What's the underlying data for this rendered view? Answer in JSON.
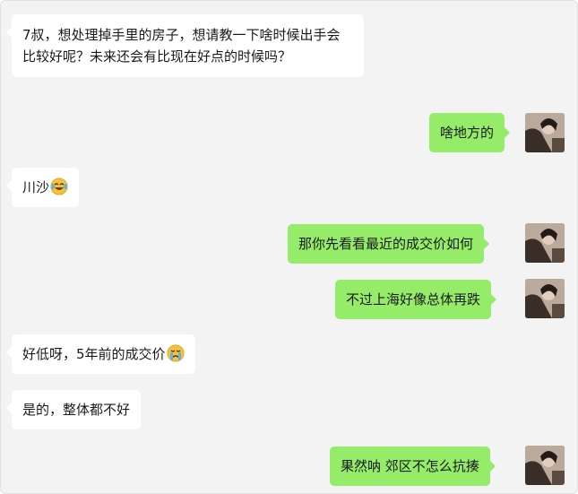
{
  "messages": [
    {
      "side": "in",
      "text": "7叔，想处理掉手里的房子，想请教一下啥时候出手会比较好呢？未来还会有比现在好点的时候吗？"
    },
    {
      "side": "out",
      "text": "啥地方的"
    },
    {
      "side": "in",
      "text": "川沙",
      "emoji": "laughing-tears-emoji"
    },
    {
      "side": "out",
      "text": "那你先看看最近的成交价如何"
    },
    {
      "side": "out",
      "text": "不过上海好像总体再跌"
    },
    {
      "side": "in",
      "text": "好低呀，5年前的成交价",
      "emoji": "crying-emoji"
    },
    {
      "side": "in",
      "text": "是的，整体都不好"
    },
    {
      "side": "out",
      "text": "果然呐 郊区不怎么抗揍"
    }
  ],
  "colors": {
    "incoming": "#ffffff",
    "outgoing": "#95ec69",
    "background": "#f3f3f3"
  }
}
